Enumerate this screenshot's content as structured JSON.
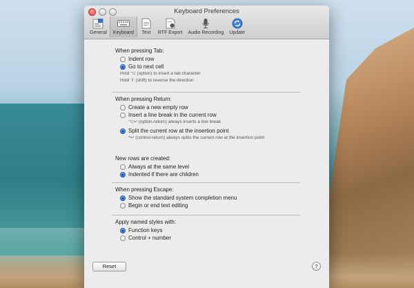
{
  "window": {
    "title": "Keyboard Preferences"
  },
  "toolbar": {
    "items": [
      {
        "label": "General",
        "icon": "general-icon"
      },
      {
        "label": "Keyboard",
        "icon": "keyboard-icon"
      },
      {
        "label": "Text",
        "icon": "text-icon"
      },
      {
        "label": "RTF Export",
        "icon": "rtf-export-icon"
      },
      {
        "label": "Audio Recording",
        "icon": "microphone-icon"
      },
      {
        "label": "Update",
        "icon": "update-icon"
      }
    ],
    "selected": "Keyboard"
  },
  "tab": {
    "heading": "When pressing Tab:",
    "options": [
      {
        "label": "Indent row",
        "selected": false
      },
      {
        "label": "Go to next cell",
        "selected": true
      }
    ],
    "hints": [
      "Hold ⌥ (option) to insert a tab character",
      "Hold ⇧ (shift) to reverse the direction"
    ]
  },
  "return": {
    "heading": "When pressing Return:",
    "options": [
      {
        "label": "Create a new empty row",
        "selected": false
      },
      {
        "label": "Insert a line break in the current row",
        "selected": false
      },
      {
        "label": "Split the current row at the insertion point",
        "selected": true
      }
    ],
    "hint_line_break": "⌥↩ (option-return) always inserts a line break",
    "hint_split": "^↩ (control-return) always splits the current row at the insertion point"
  },
  "new_rows": {
    "heading": "New rows are created:",
    "options": [
      {
        "label": "Always at the same level",
        "selected": false
      },
      {
        "label": "Indented if there are children",
        "selected": true
      }
    ]
  },
  "escape": {
    "heading": "When pressing Escape:",
    "options": [
      {
        "label": "Show the standard system completion menu",
        "selected": true
      },
      {
        "label": "Begin or end text editing",
        "selected": false
      }
    ]
  },
  "styles": {
    "heading": "Apply named styles with:",
    "options": [
      {
        "label": "Function keys",
        "selected": true
      },
      {
        "label": "Control + number",
        "selected": false
      }
    ]
  },
  "footer": {
    "reset_label": "Reset",
    "help_label": "?"
  },
  "colors": {
    "accent": "#2b73d9",
    "window_bg": "#ececec",
    "close_button": "#e0463e"
  }
}
